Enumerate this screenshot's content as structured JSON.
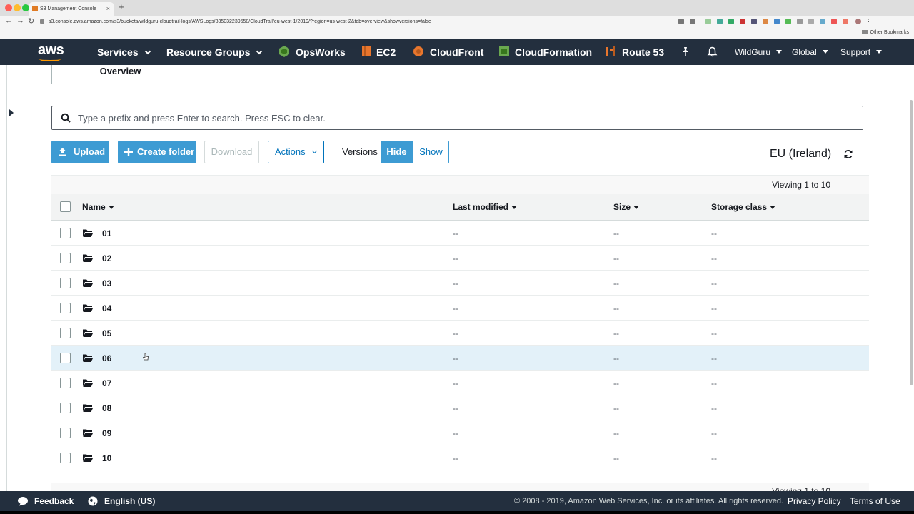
{
  "browser": {
    "tab_title": "S3 Management Console",
    "url": "s3.console.aws.amazon.com/s3/buckets/wildguru-cloudtrail-logs/AWSLogs/835032239558/CloudTrail/eu-west-1/2019/?region=us-west-2&tab=overview&showversions=false",
    "bookmarks_label": "Other Bookmarks"
  },
  "nav": {
    "logo": "aws",
    "services": "Services",
    "resource_groups": "Resource Groups",
    "shortcuts": [
      "OpsWorks",
      "EC2",
      "CloudFront",
      "CloudFormation",
      "Route 53"
    ],
    "account": "WildGuru",
    "region": "Global",
    "support": "Support"
  },
  "tabs": {
    "overview": "Overview"
  },
  "search": {
    "placeholder": "Type a prefix and press Enter to search. Press ESC to clear."
  },
  "toolbar": {
    "upload": "Upload",
    "create_folder": "Create folder",
    "download": "Download",
    "actions": "Actions",
    "versions_label": "Versions",
    "hide": "Hide",
    "show": "Show",
    "region": "EU (Ireland)"
  },
  "viewing": "Viewing 1 to 10",
  "table": {
    "columns": [
      "Name",
      "Last modified",
      "Size",
      "Storage class"
    ],
    "rows": [
      {
        "name": "01",
        "modified": "--",
        "size": "--",
        "storage": "--"
      },
      {
        "name": "02",
        "modified": "--",
        "size": "--",
        "storage": "--"
      },
      {
        "name": "03",
        "modified": "--",
        "size": "--",
        "storage": "--"
      },
      {
        "name": "04",
        "modified": "--",
        "size": "--",
        "storage": "--"
      },
      {
        "name": "05",
        "modified": "--",
        "size": "--",
        "storage": "--"
      },
      {
        "name": "06",
        "modified": "--",
        "size": "--",
        "storage": "--"
      },
      {
        "name": "07",
        "modified": "--",
        "size": "--",
        "storage": "--"
      },
      {
        "name": "08",
        "modified": "--",
        "size": "--",
        "storage": "--"
      },
      {
        "name": "09",
        "modified": "--",
        "size": "--",
        "storage": "--"
      },
      {
        "name": "10",
        "modified": "--",
        "size": "--",
        "storage": "--"
      }
    ]
  },
  "footer": {
    "feedback": "Feedback",
    "language": "English (US)",
    "copyright": "© 2008 - 2019, Amazon Web Services, Inc. or its affiliates. All rights reserved.",
    "privacy": "Privacy Policy",
    "terms": "Terms of Use"
  },
  "colors": {
    "nav_bg": "#232f3e",
    "primary": "#3d9bd3",
    "link": "#0073bb",
    "selected_row": "#e3f1f9"
  }
}
